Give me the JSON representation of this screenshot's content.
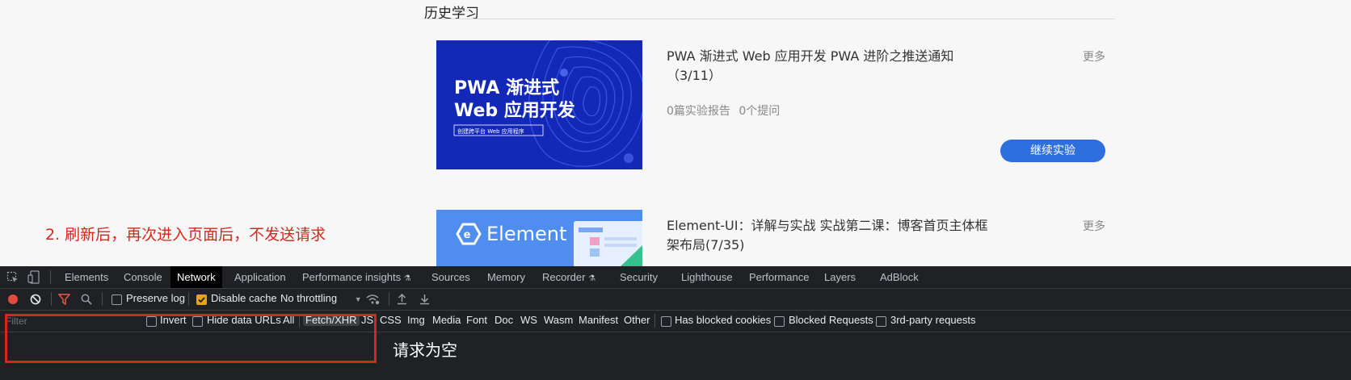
{
  "section": {
    "title": "历史学习"
  },
  "courses": [
    {
      "title": "PWA 渐进式 Web 应用开发 PWA 进阶之推送通知（3/11）",
      "more": "更多",
      "meta": "0篇实验报告 0个提问",
      "button": "继续实验",
      "thumb": {
        "line1": "PWA 渐进式",
        "line2": "Web 应用开发",
        "tag": "创建跨平台 Web 应用程序"
      }
    },
    {
      "title": "Element-UI：详解与实战 实战第二课：博客首页主体框架布局(7/35)",
      "more": "更多",
      "thumb": {
        "line1": "Element"
      }
    }
  ],
  "annotations": {
    "refresh_note": "2. 刷新后，再次进入页面后，不发送请求",
    "empty_note": "请求为空"
  },
  "devtools": {
    "tabs": [
      "Elements",
      "Console",
      "Network",
      "Application",
      "Performance insights",
      "Sources",
      "Memory",
      "Recorder",
      "Security",
      "Lighthouse",
      "Performance",
      "Layers",
      "AdBlock"
    ],
    "active_tab": "Network",
    "toolbar": {
      "preserve_log": "Preserve log",
      "preserve_log_checked": false,
      "disable_cache": "Disable cache",
      "disable_cache_checked": true,
      "throttling": "No throttling"
    },
    "filterbar": {
      "placeholder": "Filter",
      "invert": "Invert",
      "hide_data_urls": "Hide data URLs",
      "types": [
        "All",
        "Fetch/XHR",
        "JS",
        "CSS",
        "Img",
        "Media",
        "Font",
        "Doc",
        "WS",
        "Wasm",
        "Manifest",
        "Other"
      ],
      "active_type": "Fetch/XHR",
      "has_blocked_cookies": "Has blocked cookies",
      "blocked_requests": "Blocked Requests",
      "third_party": "3rd-party requests"
    },
    "colors": {
      "record": "#e04a3f",
      "filter_icon": "#e8584a",
      "checkbox_on": "#e8a317",
      "accent_button": "#2e6fde",
      "annotation_red": "#d7261e"
    }
  }
}
